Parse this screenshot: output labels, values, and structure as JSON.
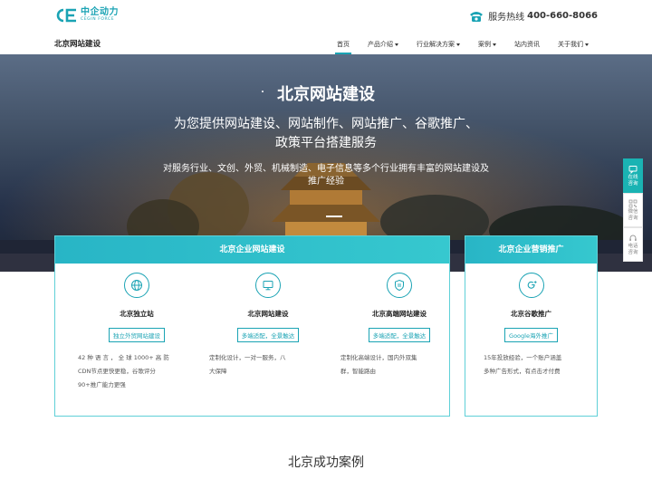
{
  "brand": {
    "logo_cn": "中企动力",
    "logo_en": "CEGIN FORCE",
    "accent": "#1aa3b4"
  },
  "header": {
    "hotline_label": "服务热线",
    "hotline_number": "400-660-8066"
  },
  "nav": {
    "site_name": "北京网站建设",
    "items": [
      {
        "label": "首页",
        "active": true
      },
      {
        "label": "产品介绍",
        "dropdown": true
      },
      {
        "label": "行业解决方案",
        "dropdown": true
      },
      {
        "label": "案例",
        "dropdown": true
      },
      {
        "label": "站内资讯"
      },
      {
        "label": "关于我们",
        "dropdown": true
      }
    ]
  },
  "hero": {
    "title": "北京网站建设",
    "subtitle_line1": "为您提供网站建设、网站制作、网站推广、谷歌推广、",
    "subtitle_line2": "政策平台搭建服务",
    "desc_line1": "对服务行业、文创、外贸、机械制造、电子信息等多个行业拥有丰富的网站建设及",
    "desc_line2": "推广经验"
  },
  "sidebar": {
    "items": [
      {
        "label": "在线咨询",
        "icon": "chat-icon"
      },
      {
        "label": "微信咨询",
        "icon": "qrcode-icon"
      },
      {
        "label": "电话咨询",
        "icon": "headset-icon"
      }
    ]
  },
  "card_main": {
    "title": "北京企业网站建设",
    "columns": [
      {
        "icon": "globe-icon",
        "name": "北京独立站",
        "tag": "独立外贸网站建设",
        "desc_lines": [
          "42 种 语 言 ， 全 球 1000+ 高 防",
          "CDN节点更快更稳，谷歌评分",
          "90+推广能力更强"
        ]
      },
      {
        "icon": "monitor-icon",
        "name": "北京网站建设",
        "tag": "多端适配，全景触达",
        "desc_lines": [
          "定制化设计，一对一服务，八",
          "大保障"
        ]
      },
      {
        "icon": "shield-doc-icon",
        "name": "北京高端网站建设",
        "tag": "多端适配，全景触达",
        "desc_lines": [
          "定制化高端设计，国内外双集",
          "群，智能路由"
        ]
      }
    ]
  },
  "card_side": {
    "title": "北京企业营销推广",
    "column": {
      "icon": "google-plus-icon",
      "name": "北京谷歌推广",
      "tag": "Google海外推广",
      "desc_lines": [
        "15年投放经验，一个账户涵盖",
        "多种广告形式，有点击才付费"
      ]
    }
  },
  "section": {
    "title": "北京成功案例"
  }
}
